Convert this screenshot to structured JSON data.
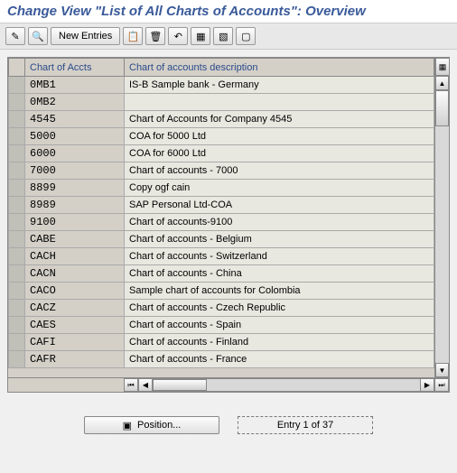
{
  "title": "Change View \"List of All Charts of Accounts\": Overview",
  "toolbar": {
    "new_entries": "New Entries"
  },
  "table": {
    "header_code": "Chart of Accts",
    "header_desc": "Chart of accounts description",
    "rows": [
      {
        "code": "0MB1",
        "desc": "IS-B Sample bank - Germany"
      },
      {
        "code": "0MB2",
        "desc": ""
      },
      {
        "code": "4545",
        "desc": "Chart of Accounts for Company 4545"
      },
      {
        "code": "5000",
        "desc": "COA for 5000 Ltd"
      },
      {
        "code": "6000",
        "desc": "COA for 6000 Ltd"
      },
      {
        "code": "7000",
        "desc": "Chart of accounts - 7000"
      },
      {
        "code": "8899",
        "desc": "Copy ogf cain"
      },
      {
        "code": "8989",
        "desc": "SAP Personal Ltd-COA"
      },
      {
        "code": "9100",
        "desc": "Chart of accounts-9100"
      },
      {
        "code": "CABE",
        "desc": "Chart of accounts - Belgium"
      },
      {
        "code": "CACH",
        "desc": "Chart of accounts - Switzerland"
      },
      {
        "code": "CACN",
        "desc": "Chart of accounts - China"
      },
      {
        "code": "CACO",
        "desc": "Sample chart of accounts for Colombia"
      },
      {
        "code": "CACZ",
        "desc": "Chart of accounts - Czech Republic"
      },
      {
        "code": "CAES",
        "desc": "Chart of accounts - Spain"
      },
      {
        "code": "CAFI",
        "desc": "Chart of accounts - Finland"
      },
      {
        "code": "CAFR",
        "desc": "Chart of accounts - France"
      }
    ]
  },
  "footer": {
    "position": "Position...",
    "entry": "Entry 1 of 37"
  }
}
